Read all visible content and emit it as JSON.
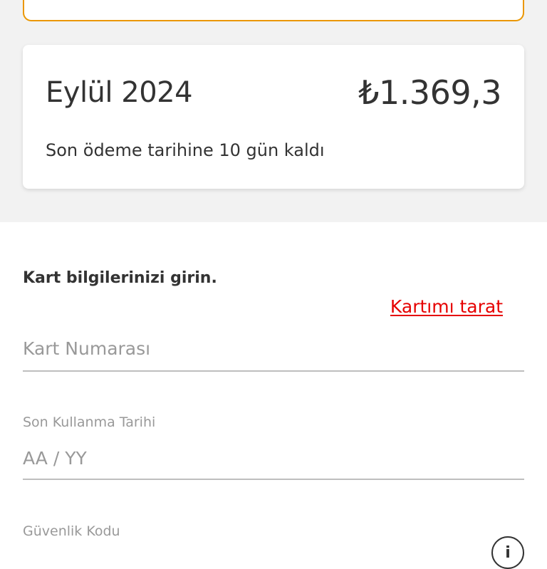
{
  "bill": {
    "month": "Eylül 2024",
    "amount": "₺1.369,3",
    "due_text": "Son ödeme tarihine 10 gün kaldı"
  },
  "form": {
    "title": "Kart bilgilerinizi girin.",
    "scan_link": "Kartımı tarat",
    "card_number": {
      "placeholder": "Kart Numarası",
      "value": ""
    },
    "expiry": {
      "label": "Son Kullanma Tarihi",
      "placeholder": "AA / YY",
      "value": ""
    },
    "cvv": {
      "label": "Güvenlik Kodu"
    }
  },
  "icons": {
    "cvv_info": "info-icon",
    "info_glyph": "i"
  },
  "colors": {
    "accent_red": "#e60000",
    "card_border_orange": "#eb9700",
    "background_gray": "#f2f2f2",
    "text_dark": "#333333",
    "text_muted": "#999999"
  }
}
